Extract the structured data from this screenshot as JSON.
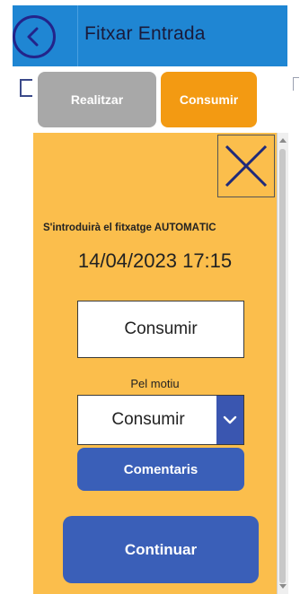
{
  "header": {
    "title": "Fitxar Entrada"
  },
  "tabs": {
    "realitzar_label": "Realitzar",
    "consumir_label": "Consumir"
  },
  "panel": {
    "info_text": "S'introduirà el fitxatge AUTOMÀTIC",
    "datetime": "14/04/2023 17:15",
    "value": "Consumir",
    "motiu_label": "Pel motiu",
    "motiu_selected": "Consumir",
    "comentaris_label": "Comentaris",
    "continuar_label": "Continuar"
  },
  "icons": {
    "back": "back-arrow-circle-icon",
    "close": "close-x-icon",
    "dropdown": "chevron-down-icon"
  },
  "colors": {
    "header": "#1f86d3",
    "panel": "#fbbe4c",
    "tab_active": "#f39a12",
    "tab_inactive": "#a8a8a8",
    "primary_button": "#3a5fb8"
  }
}
